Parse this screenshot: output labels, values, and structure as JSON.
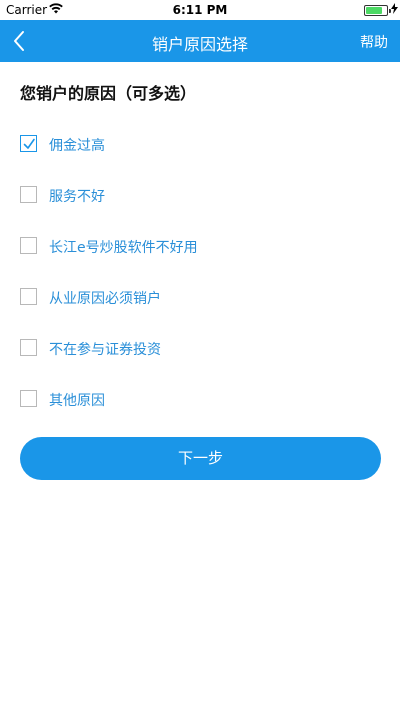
{
  "status_bar": {
    "carrier": "Carrier",
    "time": "6:11 PM",
    "battery_level": 0.8,
    "wifi_icon": "wifi-icon",
    "charging_icon": "charging-bolt-icon"
  },
  "nav": {
    "title": "销户原因选择",
    "help_label": "帮助",
    "back_icon": "chevron-left-icon",
    "background_color": "#1a96e8"
  },
  "section": {
    "title": "您销户的原因（可多选）"
  },
  "options": [
    {
      "label": "佣金过高",
      "checked": true
    },
    {
      "label": "服务不好",
      "checked": false
    },
    {
      "label": "长江e号炒股软件不好用",
      "checked": false
    },
    {
      "label": "从业原因必须销户",
      "checked": false
    },
    {
      "label": "不在参与证券投资",
      "checked": false
    },
    {
      "label": "其他原因",
      "checked": false
    }
  ],
  "next_button": {
    "label": "下一步"
  },
  "colors": {
    "accent": "#1a96e8",
    "option_text": "#2a8fd8"
  }
}
